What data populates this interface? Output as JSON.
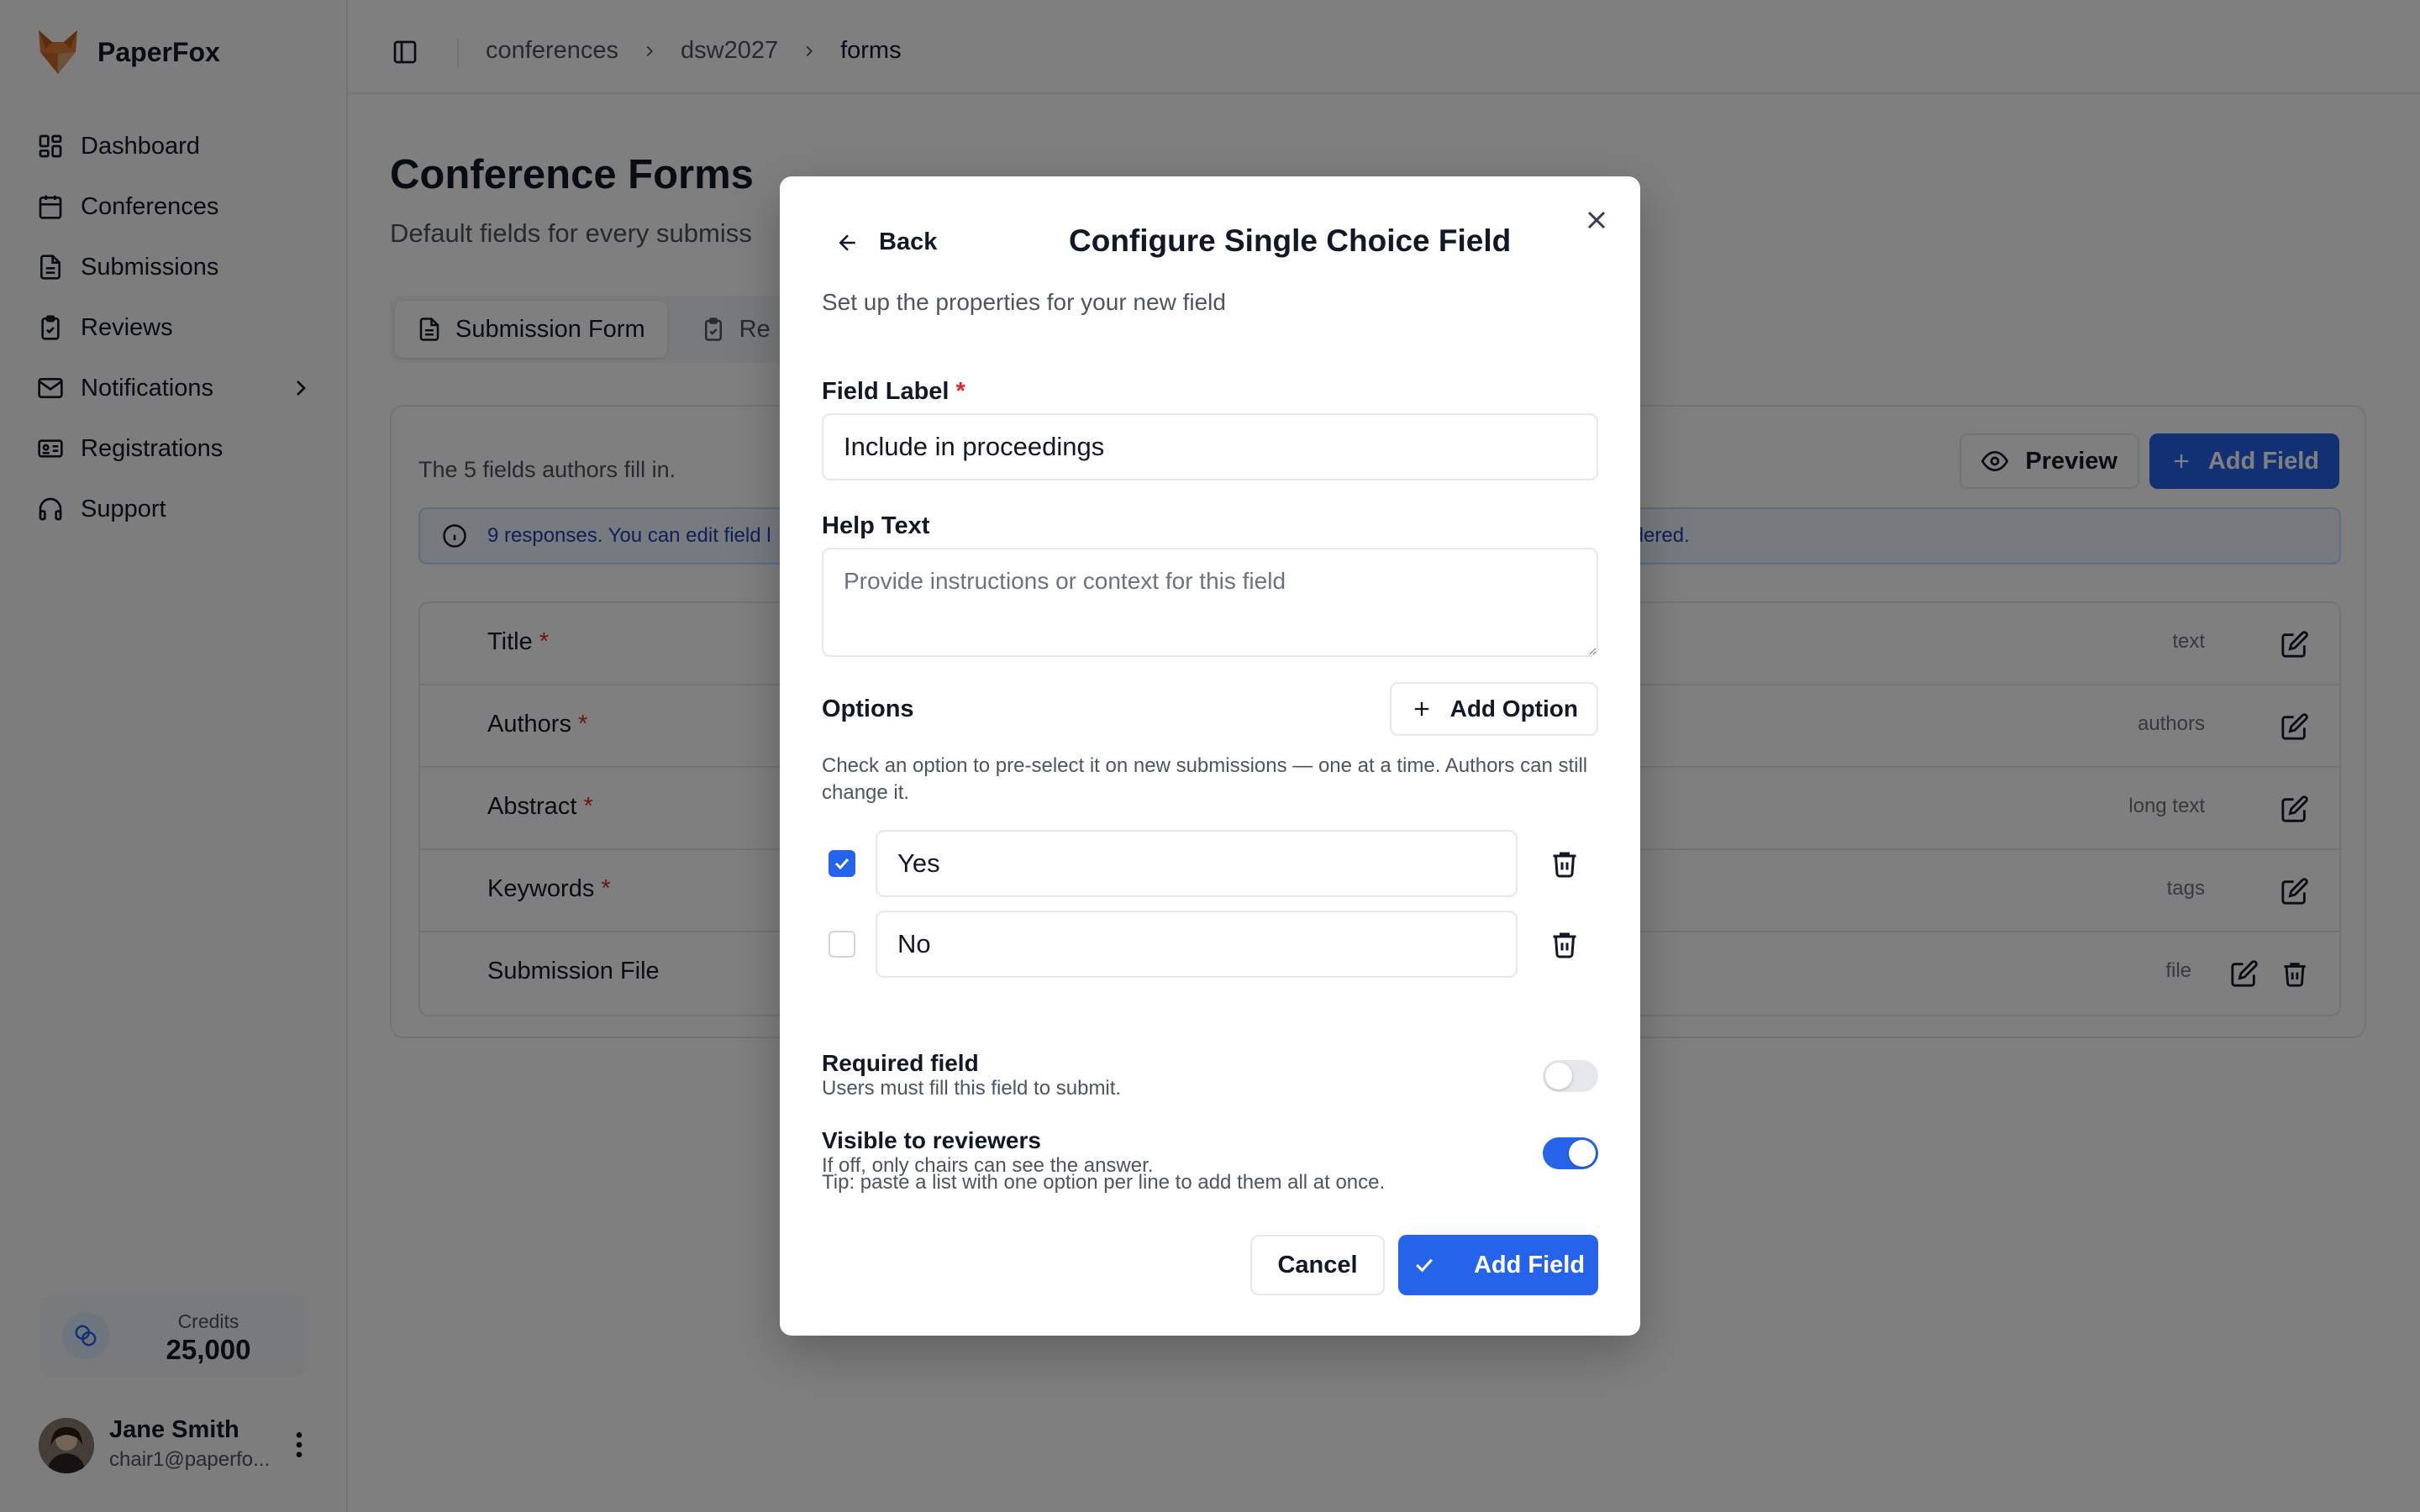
{
  "app": {
    "name": "PaperFox"
  },
  "sidebar": {
    "items": [
      {
        "label": "Dashboard",
        "icon": "dashboard-icon"
      },
      {
        "label": "Conferences",
        "icon": "calendar-icon"
      },
      {
        "label": "Submissions",
        "icon": "document-icon"
      },
      {
        "label": "Reviews",
        "icon": "clipboard-check-icon"
      },
      {
        "label": "Notifications",
        "icon": "mail-icon"
      },
      {
        "label": "Registrations",
        "icon": "id-card-icon"
      },
      {
        "label": "Support",
        "icon": "headphones-icon"
      }
    ],
    "credits": {
      "label": "Credits",
      "value": "25,000"
    },
    "user": {
      "name": "Jane Smith",
      "email": "chair1@paperfo..."
    }
  },
  "breadcrumb": [
    "conferences",
    "dsw2027",
    "forms"
  ],
  "page": {
    "title": "Conference Forms",
    "subtitle": "Default fields for every submiss",
    "tabs": [
      {
        "label": "Submission Form",
        "active": true
      },
      {
        "label": "Re",
        "active": false
      }
    ],
    "card_subtitle": "The 5 fields authors fill in.",
    "preview_label": "Preview",
    "add_field_label": "Add Field",
    "info_text": "9 responses. You can edit field l",
    "info_tail": "or reordered.",
    "fields": [
      {
        "label": "Title",
        "required": true,
        "type": "text"
      },
      {
        "label": "Authors",
        "required": true,
        "type": "authors"
      },
      {
        "label": "Abstract",
        "required": true,
        "type": "long text"
      },
      {
        "label": "Keywords",
        "required": true,
        "type": "tags"
      },
      {
        "label": "Submission File",
        "required": false,
        "type": "file"
      }
    ]
  },
  "modal": {
    "back_label": "Back",
    "title": "Configure Single Choice Field",
    "subtitle": "Set up the properties for your new field",
    "field_label": {
      "label": "Field Label",
      "value": "Include in proceedings"
    },
    "help_text": {
      "label": "Help Text",
      "placeholder": "Provide instructions or context for this field"
    },
    "options_label": "Options",
    "add_option_label": "Add Option",
    "options_hint": "Check an option to pre-select it on new submissions — one at a time. Authors can still change it.",
    "options": [
      {
        "value": "Yes",
        "checked": true
      },
      {
        "value": "No",
        "checked": false
      }
    ],
    "tip": "Tip: paste a list with one option per line to add them all at once.",
    "required": {
      "title": "Required field",
      "desc": "Users must fill this field to submit.",
      "on": false
    },
    "visible": {
      "title": "Visible to reviewers",
      "desc": "If off, only chairs can see the answer.",
      "on": true
    },
    "cancel_label": "Cancel",
    "submit_label": "Add Field"
  },
  "colors": {
    "accent": "#2563eb",
    "required": "#dc2626"
  }
}
